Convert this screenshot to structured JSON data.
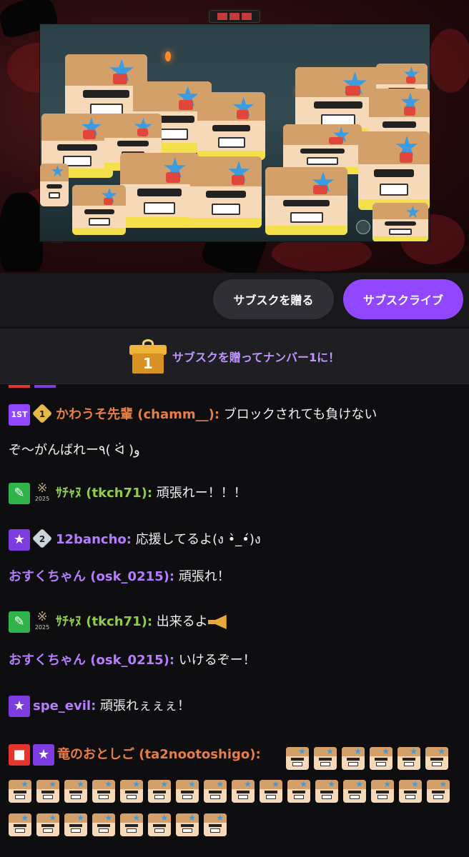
{
  "stream": {
    "frame_label": "",
    "game_name": ""
  },
  "actions": {
    "gift_label": "サブスクを贈る",
    "subscribe_label": "サブスクライブ"
  },
  "gift_banner": {
    "rank": "1",
    "text": "サブスクを贈ってナンバー1に！"
  },
  "colors": {
    "accent": "#9147ff",
    "name_orange": "#e77e45",
    "name_green": "#8fce4a",
    "name_purple": "#b67dff"
  },
  "chat": {
    "messages": [
      {
        "user": "かわうそ先輩 (chamm__)",
        "text_line1": "ブロックされても負けない",
        "text_line2": "ぞ〜がんばれー٩( ᐛ )و",
        "badges": [
          "first-gift-badge",
          "rank-1-badge"
        ],
        "first_badge_label": "1ST",
        "rank_label": "1"
      },
      {
        "user": "ｻﾁｬﾇ (tkch71)",
        "text": "頑張れー！！！",
        "badges": [
          "vip-sword-badge",
          "rank-2025-badge"
        ],
        "rank_year": "2025"
      },
      {
        "user": "12bancho",
        "text": "応援してるよ(ง •̀_•́)ง",
        "badges": [
          "sub-star-badge",
          "rank-2-badge"
        ],
        "rank_label": "2"
      },
      {
        "user": "おすくちゃん (osk_0215)",
        "text": "頑張れ！",
        "badges": []
      },
      {
        "user": "ｻﾁｬﾇ (tkch71)",
        "text": "出来るよ",
        "badges": [
          "vip-sword-badge",
          "rank-2025-badge"
        ],
        "rank_year": "2025"
      },
      {
        "user": "おすくちゃん (osk_0215)",
        "text": "いけるぞー！",
        "badges": []
      },
      {
        "user": "spe_evil",
        "text": "頑張れぇぇぇ！",
        "badges": [
          "sub-star-badge"
        ]
      },
      {
        "user": "竜のおとしご (ta2nootoshigo)",
        "text": "",
        "badges": [
          "live-camera-badge",
          "sub-star-badge"
        ],
        "emote_count": 39,
        "emote_name": "angry-kid-emote"
      }
    ]
  }
}
